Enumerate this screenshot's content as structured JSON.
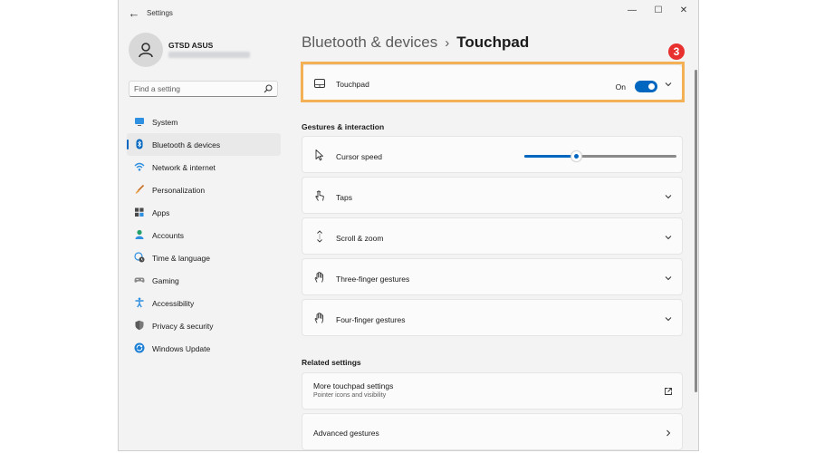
{
  "window": {
    "title": "Settings",
    "controls": {
      "minimize": "—",
      "maximize": "☐",
      "close": "✕"
    }
  },
  "user": {
    "name": "GTSD ASUS"
  },
  "search": {
    "placeholder": "Find a setting"
  },
  "sidebar": {
    "items": [
      {
        "label": "System",
        "icon": "monitor-icon",
        "active": false
      },
      {
        "label": "Bluetooth & devices",
        "icon": "bluetooth-icon",
        "active": true
      },
      {
        "label": "Network & internet",
        "icon": "wifi-icon",
        "active": false
      },
      {
        "label": "Personalization",
        "icon": "brush-icon",
        "active": false
      },
      {
        "label": "Apps",
        "icon": "apps-icon",
        "active": false
      },
      {
        "label": "Accounts",
        "icon": "person-icon",
        "active": false
      },
      {
        "label": "Time & language",
        "icon": "globe-clock-icon",
        "active": false
      },
      {
        "label": "Gaming",
        "icon": "gamepad-icon",
        "active": false
      },
      {
        "label": "Accessibility",
        "icon": "accessibility-icon",
        "active": false
      },
      {
        "label": "Privacy & security",
        "icon": "shield-icon",
        "active": false
      },
      {
        "label": "Windows Update",
        "icon": "update-icon",
        "active": false
      }
    ]
  },
  "breadcrumb": {
    "parent": "Bluetooth & devices",
    "separator": "›",
    "current": "Touchpad"
  },
  "annotation": {
    "step": "3"
  },
  "touchpad": {
    "label": "Touchpad",
    "state": "On",
    "enabled": true
  },
  "gestures": {
    "title": "Gestures & interaction",
    "cursor_speed": {
      "label": "Cursor speed",
      "value": 0.34
    },
    "items": [
      {
        "label": "Taps",
        "icon": "tap-icon"
      },
      {
        "label": "Scroll & zoom",
        "icon": "scroll-icon"
      },
      {
        "label": "Three-finger gestures",
        "icon": "hand-icon"
      },
      {
        "label": "Four-finger gestures",
        "icon": "hand-icon"
      }
    ]
  },
  "related": {
    "title": "Related settings",
    "more": {
      "label": "More touchpad settings",
      "sub": "Pointer icons and visibility"
    },
    "advanced": {
      "label": "Advanced gestures"
    }
  },
  "colors": {
    "accent": "#0067c0",
    "highlight": "#f3b054",
    "badge": "#e8312f"
  }
}
